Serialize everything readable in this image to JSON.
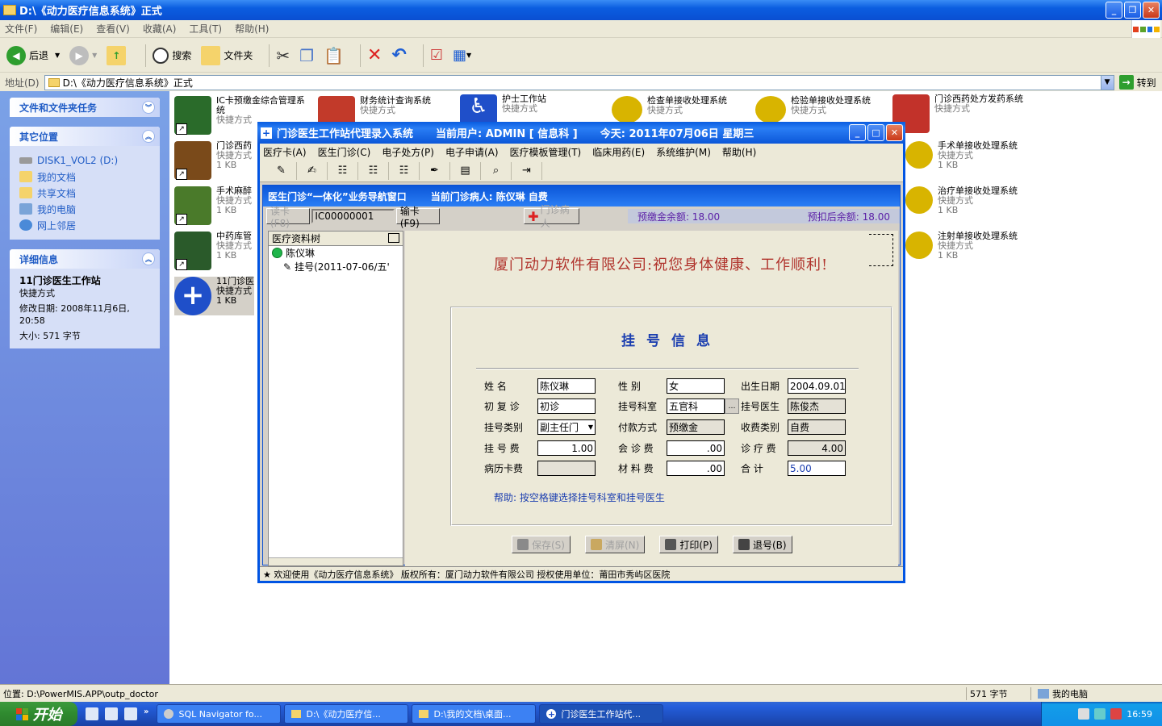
{
  "explorer": {
    "title": "D:\\《动力医疗信息系统》正式",
    "menu": [
      "文件(F)",
      "编辑(E)",
      "查看(V)",
      "收藏(A)",
      "工具(T)",
      "帮助(H)"
    ],
    "toolbar": {
      "back": "后退",
      "search": "搜索",
      "folders": "文件夹"
    },
    "address_label": "地址(D)",
    "address": "D:\\《动力医疗信息系统》正式",
    "go": "转到",
    "status_path": "位置: D:\\PowerMIS.APP\\outp_doctor",
    "status_size": "571 字节",
    "status_zone": "我的电脑"
  },
  "leftpane": {
    "tasks_header": "文件和文件夹任务",
    "other_header": "其它位置",
    "other_items": [
      "DISK1_VOL2 (D:)",
      "我的文档",
      "共享文档",
      "我的电脑",
      "网上邻居"
    ],
    "details_header": "详细信息",
    "details_name": "11门诊医生工作站",
    "details_type": "快捷方式",
    "details_date": "修改日期: 2008年11月6日, 20:58",
    "details_size": "大小: 571 字节"
  },
  "files": [
    {
      "name": "IC卡预缴金综合管理系统",
      "type": "快捷方式",
      "size": "",
      "color": "#2a6b2a"
    },
    {
      "name": "财务统计查询系统",
      "type": "快捷方式",
      "size": "",
      "color": "#c23a2a"
    },
    {
      "name": "护士工作站",
      "type": "快捷方式",
      "size": "",
      "color": "#1f4fc9"
    },
    {
      "name": "检查单接收处理系统",
      "type": "快捷方式",
      "size": "",
      "color": "#d8b400"
    },
    {
      "name": "检验单接收处理系统",
      "type": "快捷方式",
      "size": "",
      "color": "#d8b400"
    },
    {
      "name": "门诊西药处方发药系统",
      "type": "快捷方式",
      "size": "",
      "color": "#c2322a"
    },
    {
      "name": "门诊西药",
      "type": "快捷方式",
      "size": "1 KB",
      "color": "#7a4a1a"
    },
    {
      "name": "手术单接收处理系统",
      "type": "快捷方式",
      "size": "1 KB",
      "color": "#d8b400"
    },
    {
      "name": "手术麻醉",
      "type": "快捷方式",
      "size": "1 KB",
      "color": "#4a7a2a"
    },
    {
      "name": "治疗单接收处理系统",
      "type": "快捷方式",
      "size": "1 KB",
      "color": "#d8b400"
    },
    {
      "name": "中药库管",
      "type": "快捷方式",
      "size": "1 KB",
      "color": "#2a5a2a"
    },
    {
      "name": "注射单接收处理系统",
      "type": "快捷方式",
      "size": "1 KB",
      "color": "#d8b400"
    },
    {
      "name": "11门诊医",
      "type": "快捷方式",
      "size": "1 KB",
      "color": "#1f4fc9"
    }
  ],
  "app": {
    "title_name": "门诊医生工作站代理录入系统",
    "title_user": "当前用户: ADMIN [ 信息科 ]",
    "title_date": "今天: 2011年07月06日  星期三",
    "menu": [
      "医疗卡(A)",
      "医生门诊(C)",
      "电子处方(P)",
      "电子申请(A)",
      "医疗模板管理(T)",
      "临床用药(E)",
      "系统维护(M)",
      "帮助(H)"
    ],
    "inner_title": "医生门诊“一体化”业务导航窗口",
    "inner_patient": "当前门诊病人: 陈仪琳  自费",
    "read_card": "读卡(F8)",
    "card_no": "IC00000001",
    "input_card": "输卡(F9)",
    "clinic_patient": "门诊病人",
    "balance": "预缴金余额: 18.00",
    "balance_after": "预扣后余额: 18.00",
    "tree_header": "医疗资料树",
    "tree_patient": "陈仪琳",
    "tree_reg": "挂号(2011-07-06/五'",
    "greeting": "厦门动力软件有限公司:祝您身体健康、工作顺利!",
    "form_title": "挂号信息",
    "help": "帮助: 按空格键选择挂号科室和挂号医生",
    "fields": {
      "name_label": "姓    名",
      "name": "陈仪琳",
      "sex_label": "性    别",
      "sex": "女",
      "dob_label": "出生日期",
      "dob": "2004.09.01",
      "visit_label": "初 复 诊",
      "visit": "初诊",
      "dept_label": "挂号科室",
      "dept": "五官科",
      "doctor_label": "挂号医生",
      "doctor": "陈俊杰",
      "regtype_label": "挂号类别",
      "regtype": "副主任门",
      "pay_label": "付款方式",
      "pay": "预缴金",
      "feecat_label": "收费类别",
      "feecat": "自费",
      "regfee_label": "挂 号 费",
      "regfee": "1.00",
      "consult_label": "会 诊 费",
      "consult": ".00",
      "diag_label": "诊 疗 费",
      "diag": "4.00",
      "record_label": "病历卡费",
      "record": "",
      "material_label": "材 料 费",
      "material": ".00",
      "total_label": "合    计",
      "total": "5.00"
    },
    "buttons": {
      "save": "保存(S)",
      "clear": "清屏(N)",
      "print": "打印(P)",
      "refund": "退号(B)"
    },
    "status": "★ 欢迎使用《动力医疗信息系统》 版权所有：厦门动力软件有限公司 授权使用单位：莆田市秀屿区医院"
  },
  "taskbar": {
    "start": "开始",
    "tasks": [
      "SQL Navigator fo...",
      "D:\\《动力医疗信...",
      "D:\\我的文档\\桌面...",
      "门诊医生工作站代..."
    ],
    "clock": "16:59"
  }
}
